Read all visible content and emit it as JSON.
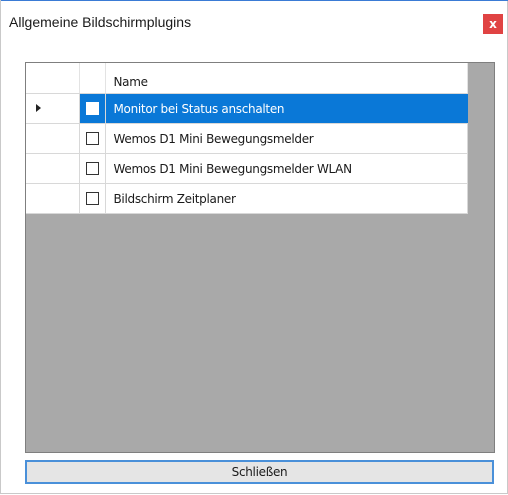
{
  "window": {
    "title": "Allgemeine Bildschirmplugins",
    "close_label": "x"
  },
  "grid": {
    "columns": [
      "",
      "",
      "Name"
    ],
    "rows": [
      {
        "name": "Monitor bei Status anschalten",
        "checked": false,
        "selected": true
      },
      {
        "name": "Wemos D1 Mini Bewegungsmelder",
        "checked": false,
        "selected": false
      },
      {
        "name": "Wemos D1 Mini Bewegungsmelder WLAN",
        "checked": false,
        "selected": false
      },
      {
        "name": "Bildschirm Zeitplaner",
        "checked": false,
        "selected": false
      }
    ]
  },
  "footer": {
    "close_button_label": "Schließen"
  },
  "colors": {
    "selection": "#0a78d7",
    "close_button": "#e04343",
    "grid_background": "#a9a9a9",
    "focus_border": "#4a90d9"
  },
  "icons": {
    "close": "close-icon",
    "row_indicator": "row-selector-arrow-icon"
  }
}
